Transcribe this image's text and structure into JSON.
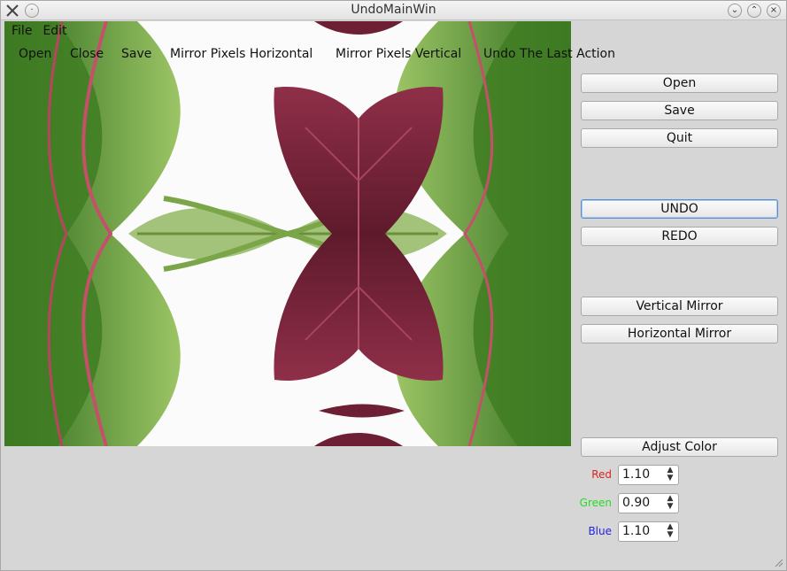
{
  "window": {
    "title": "UndoMainWin"
  },
  "menu": {
    "file": "File",
    "edit": "Edit"
  },
  "toolbar": {
    "open": "Open",
    "close": "Close",
    "save": "Save",
    "mirror_h": "Mirror Pixels Horizontal",
    "mirror_v": "Mirror Pixels Vertical",
    "undo_last": "Undo The Last Action"
  },
  "panel": {
    "open": "Open",
    "save": "Save",
    "quit": "Quit",
    "undo": "UNDO",
    "redo": "REDO",
    "vertical_mirror": "Vertical Mirror",
    "horizontal_mirror": "Horizontal Mirror",
    "adjust_color": "Adjust Color",
    "red_label": "Red",
    "green_label": "Green",
    "blue_label": "Blue",
    "red_value": "1.10",
    "green_value": "0.90",
    "blue_value": "1.10"
  },
  "colors": {
    "red": "#dd2222",
    "green": "#22dd22",
    "blue": "#2222dd",
    "focus_border": "#5b8fd1",
    "leaf_dark": "#7a2438",
    "leaf_green": "#4f8a2a"
  },
  "icons": {
    "app": "tools-icon",
    "sticky": "pin-icon",
    "minimize": "chevron-down-icon",
    "maximize": "chevron-up-icon",
    "close": "close-icon"
  }
}
